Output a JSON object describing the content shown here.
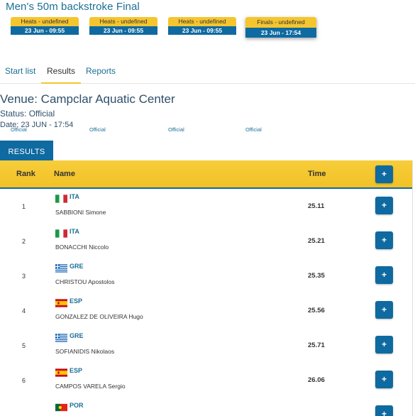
{
  "event_title": "Men's 50m backstroke Final",
  "heats": [
    {
      "label": "Heats - undefined",
      "date": "23 Jun - 09:55",
      "status": "Official"
    },
    {
      "label": "Heats - undefined",
      "date": "23 Jun - 09:55",
      "status": "Official"
    },
    {
      "label": "Heats - undefined",
      "date": "23 Jun - 09:55",
      "status": "Official"
    },
    {
      "label": "Finals - undefined",
      "date": "23 Jun - 17:54",
      "status": "Official"
    }
  ],
  "tabs": [
    {
      "label": "Start list"
    },
    {
      "label": "Results"
    },
    {
      "label": "Reports"
    }
  ],
  "venue": "Venue: Campclar Aquatic Center",
  "status": "Status: Official",
  "date": "Date: 23 JUN - 17:54",
  "results_tab_label": "RESULTS",
  "table": {
    "headers": {
      "rank": "Rank",
      "name": "Name",
      "time": "Time",
      "expand": "+"
    },
    "rows": [
      {
        "rank": "1",
        "country": "ITA",
        "athlete": "SABBIONI Simone",
        "time": "25.11",
        "expand": "+",
        "flag": "italy-flag-icon"
      },
      {
        "rank": "2",
        "country": "ITA",
        "athlete": "BONACCHI Niccolo",
        "time": "25.21",
        "expand": "+",
        "flag": "italy-flag-icon"
      },
      {
        "rank": "3",
        "country": "GRE",
        "athlete": "CHRISTOU Apostolos",
        "time": "25.35",
        "expand": "+",
        "flag": "greece-flag-icon"
      },
      {
        "rank": "4",
        "country": "ESP",
        "athlete": "GONZALEZ DE OLIVEIRA Hugo",
        "time": "25.56",
        "expand": "+",
        "flag": "spain-flag-icon"
      },
      {
        "rank": "5",
        "country": "GRE",
        "athlete": "SOFIANIDIS Nikolaos",
        "time": "25.71",
        "expand": "+",
        "flag": "greece-flag-icon"
      },
      {
        "rank": "6",
        "country": "ESP",
        "athlete": "CAMPOS VARELA Sergio",
        "time": "26.06",
        "expand": "+",
        "flag": "spain-flag-icon"
      },
      {
        "rank": "",
        "country": "POR",
        "athlete": "",
        "time": "",
        "expand": "+",
        "flag": "portugal-flag-icon"
      }
    ]
  },
  "colors": {
    "accent_blue": "#0e6aa0",
    "accent_yellow": "#f5c530",
    "link": "#1b6f94"
  }
}
